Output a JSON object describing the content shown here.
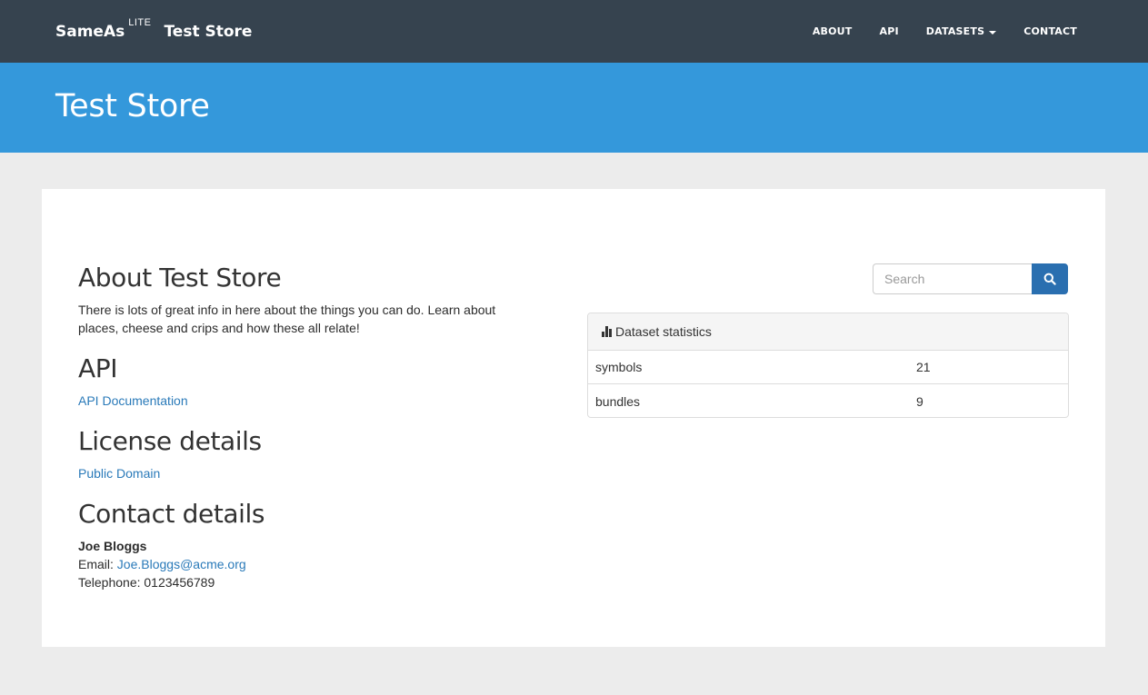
{
  "navbar": {
    "brand": "SameAs",
    "brand_sup": "LITE",
    "store": "Test Store",
    "links": [
      {
        "label": "ABOUT"
      },
      {
        "label": "API"
      },
      {
        "label": "DATASETS"
      },
      {
        "label": "CONTACT"
      }
    ]
  },
  "header": {
    "title": "Test Store"
  },
  "about": {
    "heading": "About Test Store",
    "text": "There is lots of great info in here about the things you can do. Learn about places, cheese and crips and how these all relate!"
  },
  "api": {
    "heading": "API",
    "link": "API Documentation"
  },
  "license": {
    "heading": "License details",
    "link": "Public Domain"
  },
  "contact": {
    "heading": "Contact details",
    "name": "Joe Bloggs",
    "email_label": "Email: ",
    "email": "Joe.Bloggs@acme.org",
    "telephone": "Telephone: 0123456789"
  },
  "search": {
    "placeholder": "Search",
    "icon": "search-icon"
  },
  "stats": {
    "title": "Dataset statistics",
    "icon": "bar-chart-icon",
    "rows": [
      {
        "key": "symbols",
        "value": "21"
      },
      {
        "key": "bundles",
        "value": "9"
      }
    ]
  },
  "colors": {
    "navbar": "#36434f",
    "header": "#3498db",
    "link": "#2a7ab9",
    "button": "#2a6fb0"
  }
}
